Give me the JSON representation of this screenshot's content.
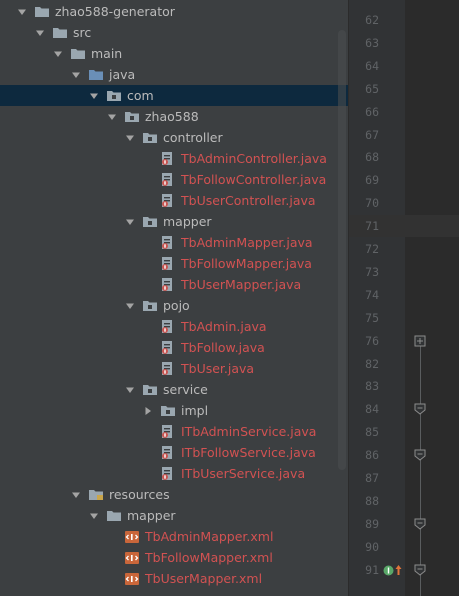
{
  "tree": [
    {
      "label": "zhao588-generator",
      "depth": 0,
      "expand": "open",
      "icon": "folder",
      "kind": "dir"
    },
    {
      "label": "src",
      "depth": 1,
      "expand": "open",
      "icon": "folder",
      "kind": "dir"
    },
    {
      "label": "main",
      "depth": 2,
      "expand": "open",
      "icon": "folder",
      "kind": "dir"
    },
    {
      "label": "java",
      "depth": 3,
      "expand": "open",
      "icon": "folder-source",
      "kind": "dir"
    },
    {
      "label": "com",
      "depth": 4,
      "expand": "open",
      "icon": "package-folder",
      "kind": "dir",
      "selected": true
    },
    {
      "label": "zhao588",
      "depth": 5,
      "expand": "open",
      "icon": "package-folder",
      "kind": "dir"
    },
    {
      "label": "controller",
      "depth": 6,
      "expand": "open",
      "icon": "package-folder",
      "kind": "dir"
    },
    {
      "label": "TbAdminController.java",
      "depth": 7,
      "expand": "none",
      "icon": "java-file",
      "kind": "java"
    },
    {
      "label": "TbFollowController.java",
      "depth": 7,
      "expand": "none",
      "icon": "java-file",
      "kind": "java"
    },
    {
      "label": "TbUserController.java",
      "depth": 7,
      "expand": "none",
      "icon": "java-file",
      "kind": "java"
    },
    {
      "label": "mapper",
      "depth": 6,
      "expand": "open",
      "icon": "package-folder",
      "kind": "dir"
    },
    {
      "label": "TbAdminMapper.java",
      "depth": 7,
      "expand": "none",
      "icon": "java-file",
      "kind": "java"
    },
    {
      "label": "TbFollowMapper.java",
      "depth": 7,
      "expand": "none",
      "icon": "java-file",
      "kind": "java"
    },
    {
      "label": "TbUserMapper.java",
      "depth": 7,
      "expand": "none",
      "icon": "java-file",
      "kind": "java"
    },
    {
      "label": "pojo",
      "depth": 6,
      "expand": "open",
      "icon": "package-folder",
      "kind": "dir"
    },
    {
      "label": "TbAdmin.java",
      "depth": 7,
      "expand": "none",
      "icon": "java-file",
      "kind": "java"
    },
    {
      "label": "TbFollow.java",
      "depth": 7,
      "expand": "none",
      "icon": "java-file",
      "kind": "java"
    },
    {
      "label": "TbUser.java",
      "depth": 7,
      "expand": "none",
      "icon": "java-file",
      "kind": "java"
    },
    {
      "label": "service",
      "depth": 6,
      "expand": "open",
      "icon": "package-folder",
      "kind": "dir"
    },
    {
      "label": "impl",
      "depth": 7,
      "expand": "closed",
      "icon": "package-folder",
      "kind": "dir"
    },
    {
      "label": "ITbAdminService.java",
      "depth": 7,
      "expand": "none",
      "icon": "java-file",
      "kind": "java"
    },
    {
      "label": "ITbFollowService.java",
      "depth": 7,
      "expand": "none",
      "icon": "java-file",
      "kind": "java"
    },
    {
      "label": "ITbUserService.java",
      "depth": 7,
      "expand": "none",
      "icon": "java-file",
      "kind": "java"
    },
    {
      "label": "resources",
      "depth": 3,
      "expand": "open",
      "icon": "folder-resources",
      "kind": "dir"
    },
    {
      "label": "mapper",
      "depth": 4,
      "expand": "open",
      "icon": "folder",
      "kind": "dir"
    },
    {
      "label": "TbAdminMapper.xml",
      "depth": 5,
      "expand": "none",
      "icon": "xml-file",
      "kind": "xml"
    },
    {
      "label": "TbFollowMapper.xml",
      "depth": 5,
      "expand": "none",
      "icon": "xml-file",
      "kind": "xml"
    },
    {
      "label": "TbUserMapper.xml",
      "depth": 5,
      "expand": "none",
      "icon": "xml-file",
      "kind": "xml"
    }
  ],
  "gutter": {
    "line_numbers": [
      "62",
      "63",
      "64",
      "65",
      "66",
      "67",
      "68",
      "69",
      "70",
      "71",
      "72",
      "73",
      "74",
      "75",
      "76",
      "82",
      "83",
      "84",
      "85",
      "86",
      "87",
      "88",
      "89",
      "90",
      "91"
    ],
    "fold_markers": [
      {
        "line": "76",
        "icon": "fold-expand-icon"
      },
      {
        "line": "84",
        "icon": "fold-collapse-icon"
      },
      {
        "line": "86",
        "icon": "fold-collapse-icon"
      },
      {
        "line": "89",
        "icon": "fold-collapse-icon"
      },
      {
        "line": "91",
        "icon": "fold-collapse-icon"
      }
    ],
    "caret_line": "71",
    "override_marker_line": "91"
  },
  "colors": {
    "panel_bg": "#3c3f41",
    "selection": "#0d293e",
    "text": "#bbbbbb",
    "modified_file": "#d25252",
    "gutter_bg": "#313335",
    "line_number": "#606366",
    "editor_bg": "#2b2b2b"
  }
}
